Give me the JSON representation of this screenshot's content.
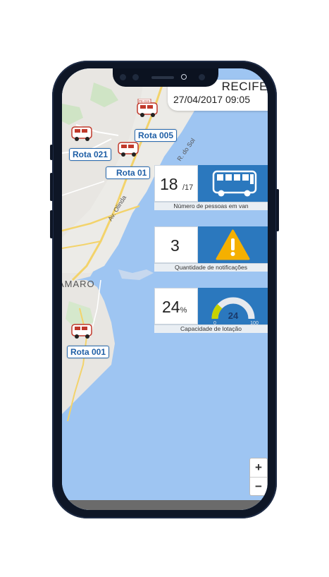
{
  "header": {
    "city": "RECIFE",
    "datetime": "27/04/2017 09:05"
  },
  "map": {
    "street_labels": [
      "Av. Olinda",
      "R. do Sol"
    ],
    "district_label": "AMARO",
    "routes": [
      "Rota 005",
      "Rota 021",
      "Rota 01",
      "Rota 001"
    ],
    "van_plate": "PE-015"
  },
  "stats": {
    "passengers": {
      "value": "18",
      "total": "/17",
      "caption": "Número de pessoas em van",
      "icon": "bus-icon"
    },
    "notifications": {
      "value": "3",
      "caption": "Quantidade de notificações",
      "icon": "warning-icon"
    },
    "capacity": {
      "value": "24",
      "unit": "%",
      "caption": "Capacidade de lotação",
      "icon": "gauge-icon",
      "gauge_value": "24",
      "gauge_min": "0",
      "gauge_max": "100",
      "gauge_fraction": 0.24
    }
  },
  "zoom": {
    "plus": "+",
    "minus": "−"
  },
  "colors": {
    "water": "#9ec5f2",
    "panel_blue": "#2b78be",
    "route_label": "#1f5fa6",
    "warning": "#f5b000"
  }
}
